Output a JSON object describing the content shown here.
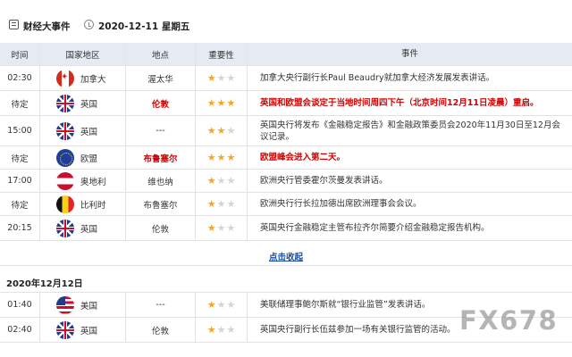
{
  "header": {
    "title": "财经大事件",
    "date": "2020-12-11 星期五"
  },
  "columns": {
    "time": "时间",
    "country": "国家地区",
    "location": "地点",
    "importance": "重要性",
    "event": "事件"
  },
  "events": [
    {
      "time": "02:30",
      "flag": "ca",
      "country": "加拿大",
      "location": "渥太华",
      "stars": 1,
      "event": "加拿大央行副行长Paul Beaudry就加拿大经济发展发表讲话。",
      "highlight": false
    },
    {
      "time": "待定",
      "flag": "uk",
      "country": "英国",
      "location": "伦敦",
      "stars": 3,
      "event": "英国和欧盟会谈定于当地时间周四下午（北京时间12月11日凌晨）重启。",
      "highlight": true
    },
    {
      "time": "15:00",
      "flag": "uk",
      "country": "英国",
      "location": "---",
      "stars": 2,
      "event": "英国央行将发布《金融稳定报告》和金融政策委员会2020年11月30日至12月会议记录。",
      "highlight": false
    },
    {
      "time": "待定",
      "flag": "eu",
      "country": "欧盟",
      "location": "布鲁塞尔",
      "stars": 3,
      "event": "欧盟峰会进入第二天。",
      "highlight": true
    },
    {
      "time": "17:00",
      "flag": "at",
      "country": "奥地利",
      "location": "维也纳",
      "stars": 1,
      "event": "欧洲央行管委霍尔茨曼发表讲话。",
      "highlight": false
    },
    {
      "time": "待定",
      "flag": "be",
      "country": "比利时",
      "location": "布鲁塞尔",
      "stars": 1,
      "event": "欧洲央行行长拉加德出席欧洲理事会会议。",
      "highlight": false
    },
    {
      "time": "20:15",
      "flag": "uk",
      "country": "英国",
      "location": "伦敦",
      "stars": 1,
      "event": "英国央行金融稳定主管布拉齐尔简要介绍金融稳定报告机构。",
      "highlight": false
    }
  ],
  "collapse_label": "点击收起",
  "day2": {
    "date": "2020年12月12日",
    "events": [
      {
        "time": "01:40",
        "flag": "us",
        "country": "美国",
        "location": "---",
        "stars": 1,
        "event": "美联储理事鲍尔斯就“银行业监管”发表讲话。",
        "highlight": false
      },
      {
        "time": "02:40",
        "flag": "uk",
        "country": "英国",
        "location": "伦敦",
        "stars": 1,
        "event": "英国央行副行长伍兹参加一场有关银行监管的活动。",
        "highlight": false
      }
    ]
  },
  "watermark": "FX678"
}
